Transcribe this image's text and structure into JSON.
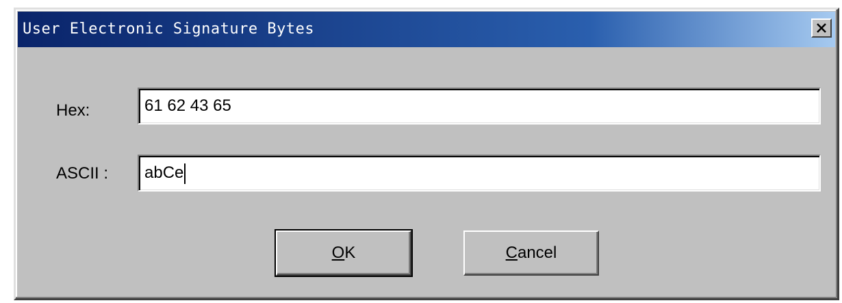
{
  "dialog": {
    "title": "User Electronic Signature Bytes",
    "close_icon": "close-x-icon",
    "colors": {
      "titlebar_start": "#0a246a",
      "titlebar_end": "#a6caf0",
      "face": "#c0c0c0"
    }
  },
  "fields": {
    "hex": {
      "label": "Hex:",
      "value": "61 62 43 65"
    },
    "ascii": {
      "label": "ASCII :",
      "value": "abCe"
    }
  },
  "buttons": {
    "ok": {
      "accel": "O",
      "rest": "K"
    },
    "cancel": {
      "accel": "C",
      "rest": "ancel"
    }
  }
}
